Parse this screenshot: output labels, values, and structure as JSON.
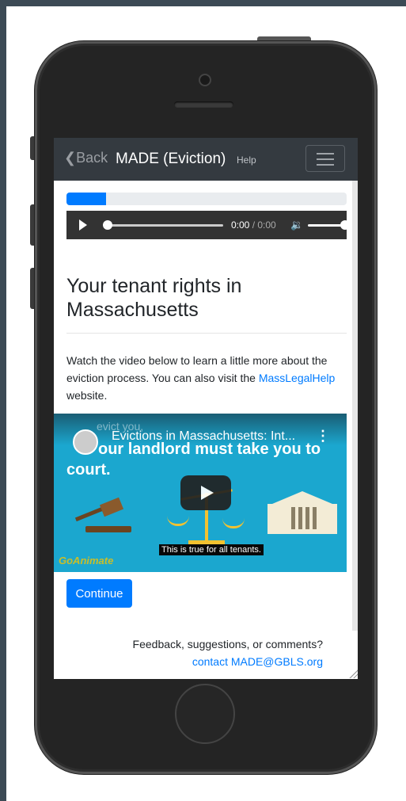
{
  "navbar": {
    "back_label": "Back",
    "brand": "MADE (Eviction)",
    "help": "Help"
  },
  "progress": {
    "value_percent": 14
  },
  "audio": {
    "current": "0:00",
    "duration": "0:00"
  },
  "page": {
    "title": "Your tenant rights in Massachusetts",
    "desc_before": "Watch the video below to learn a little more about the eviction process. You can also visit the ",
    "desc_link": "MassLegalHelp",
    "desc_after": " website."
  },
  "video": {
    "title": "Evictions in Massachusetts: Int...",
    "ghost_text": "evict you,",
    "caption_line1": "our landlord must take you to",
    "caption_line2": "court.",
    "subtitle": "This is true for all tenants.",
    "watermark": "GoAnimate"
  },
  "continue_label": "Continue",
  "footer": {
    "feedback": "Feedback, suggestions, or comments?",
    "contact": "contact MADE@GBLS.org"
  },
  "colors": {
    "primary": "#007bff",
    "navbar": "#343a40",
    "page_frame": "#3c4a55"
  }
}
